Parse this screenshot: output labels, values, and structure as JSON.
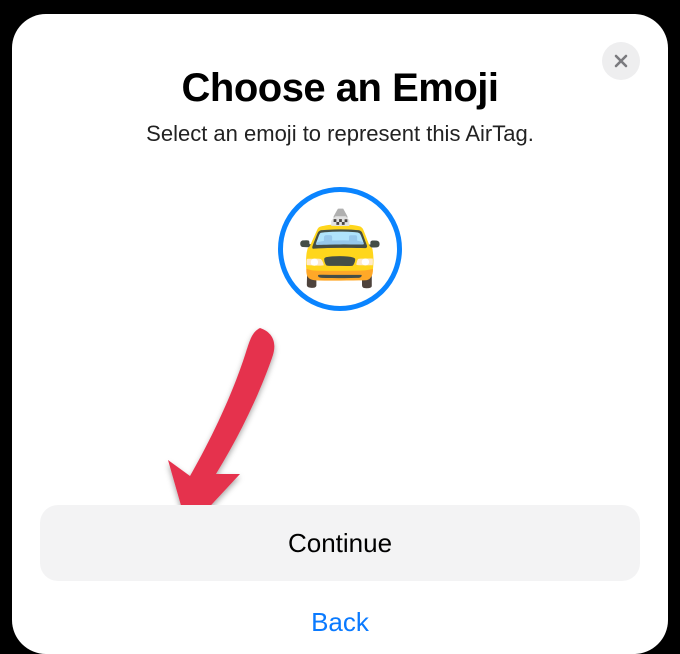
{
  "sheet": {
    "title": "Choose an Emoji",
    "subtitle": "Select an emoji to represent this AirTag.",
    "close_icon": "✕",
    "selected_emoji": "🚖",
    "accent_color": "#0a84ff"
  },
  "actions": {
    "continue_label": "Continue",
    "back_label": "Back"
  }
}
